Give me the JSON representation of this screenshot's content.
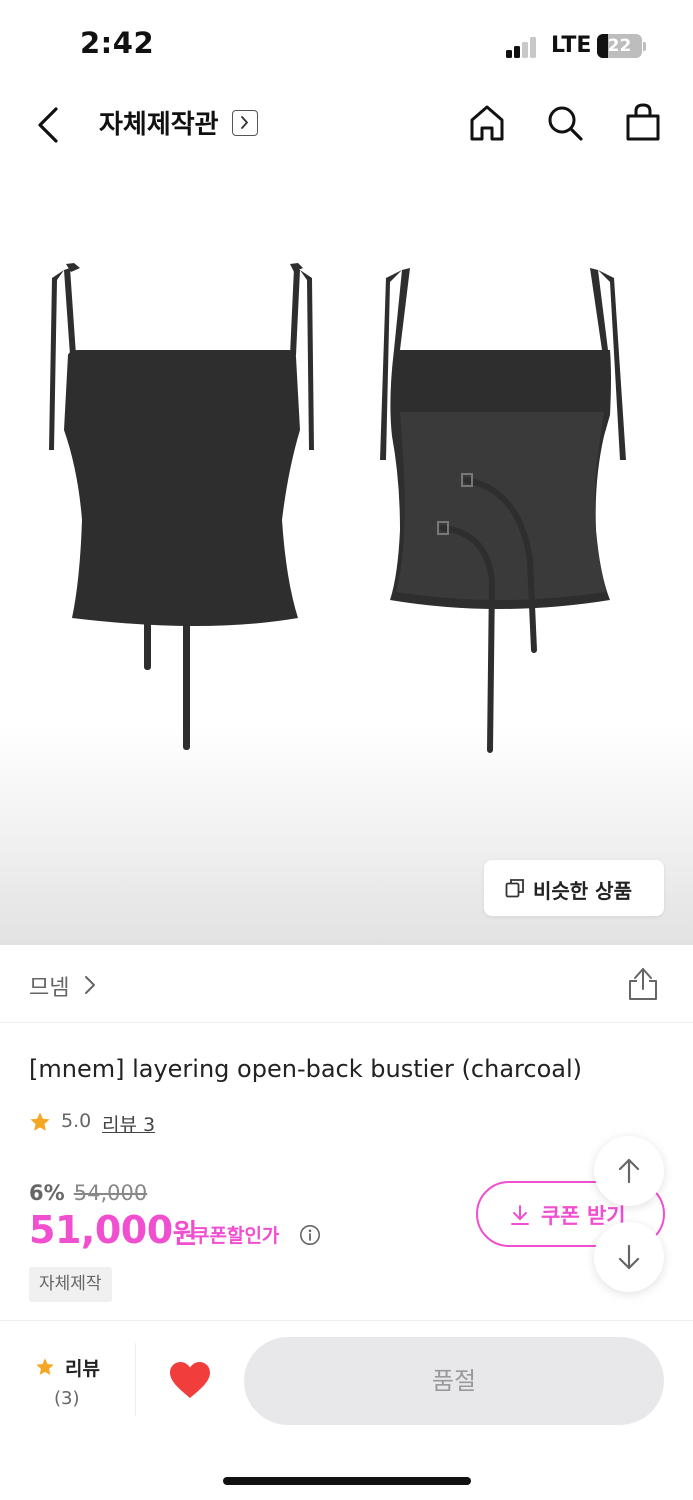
{
  "status_bar": {
    "time": "2:42",
    "network": "LTE",
    "battery": "22"
  },
  "nav": {
    "title": "자체제작관",
    "icons": [
      "back-arrow-icon",
      "chevron-right-icon",
      "home-icon",
      "search-icon",
      "shopping-bag-icon"
    ]
  },
  "product_image": {
    "similar_button_label": "비슷한 상품",
    "similar_icon": "copy-icon"
  },
  "brand": {
    "name": "므넴",
    "share_icon": "share-icon"
  },
  "product": {
    "title": "[mnem] layering open-back bustier (charcoal)",
    "rating": "5.0",
    "review_link": "리뷰 3",
    "discount_rate": "6%",
    "original_price": "54,000",
    "sale_price": "51,000",
    "sale_unit": "원",
    "coupon_price_label": "쿠폰할인가",
    "tag": "자체제작",
    "coupon_button_label": "쿠폰 받기"
  },
  "bottom_bar": {
    "review_label": "리뷰",
    "review_count": "(3)",
    "soldout_label": "품절"
  },
  "colors": {
    "accent": "#f04fd0",
    "star": "#f5a623",
    "heart": "#f23d3d",
    "garment": "#2e2e2e"
  }
}
